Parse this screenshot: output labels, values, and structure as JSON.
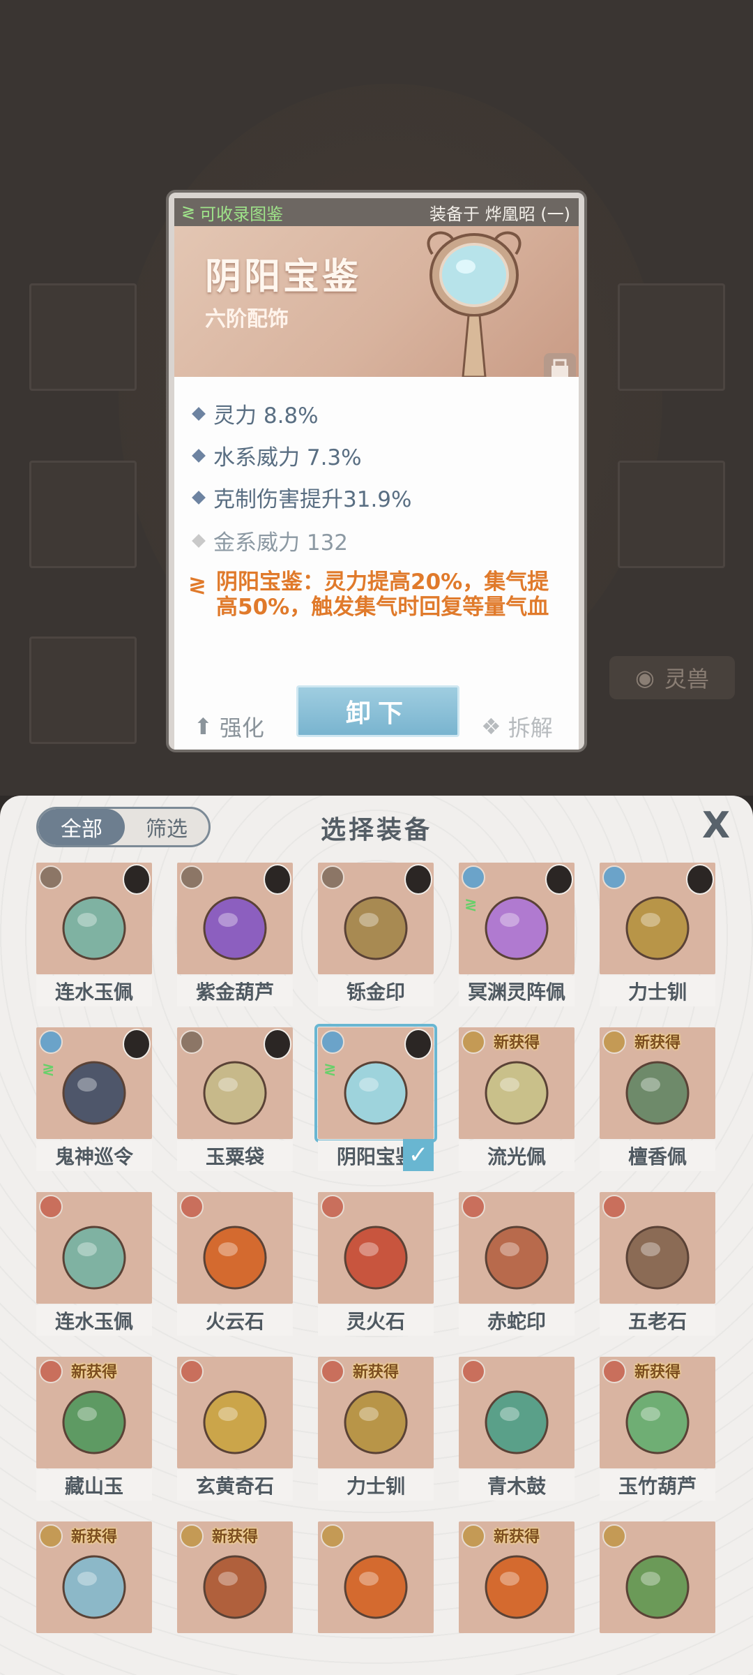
{
  "detail": {
    "collectable": "可收录图鉴",
    "equipped_on": "装备于 烨凰昭 (一)",
    "name": "阴阳宝鉴",
    "grade": "六阶配饰",
    "stats": [
      "灵力 8.8%",
      "水系威力 7.3%",
      "克制伤害提升31.9%"
    ],
    "extra_stat": "金系威力 132",
    "special": "阴阳宝鉴：灵力提高20%，集气提高50%，触发集气时回复等量气血",
    "upgrade": "强化",
    "unequip": "卸下",
    "dismantle": "拆解"
  },
  "background": {
    "beast_tab": "灵兽"
  },
  "sheet": {
    "filter_all": "全部",
    "filter_screen": "筛选",
    "title": "选择装备",
    "close": "X",
    "new_tag": "新获得",
    "items": [
      {
        "name": "连水玉佩",
        "element": "wood",
        "avatar": true,
        "new": false,
        "color": "#7fb2a2"
      },
      {
        "name": "紫金葫芦",
        "element": "wood",
        "avatar": true,
        "new": false,
        "color": "#8c5fbf"
      },
      {
        "name": "铄金印",
        "element": "wood",
        "avatar": true,
        "new": false,
        "color": "#a88a52"
      },
      {
        "name": "冥渊灵阵佩",
        "element": "water",
        "avatar": true,
        "new": false,
        "color": "#b07ad0",
        "mark": true
      },
      {
        "name": "力士钏",
        "element": "water",
        "avatar": true,
        "new": false,
        "color": "#b89548"
      },
      {
        "name": "鬼神巡令",
        "element": "water",
        "avatar": true,
        "new": false,
        "color": "#4e566a",
        "mark": true
      },
      {
        "name": "玉粟袋",
        "element": "wood",
        "avatar": true,
        "new": false,
        "color": "#c7b98a"
      },
      {
        "name": "阴阳宝鉴",
        "element": "water",
        "avatar": true,
        "new": false,
        "color": "#9ed3dc",
        "selected": true,
        "mark": true
      },
      {
        "name": "流光佩",
        "element": "gold",
        "avatar": false,
        "new": true,
        "color": "#c9c08a"
      },
      {
        "name": "檀香佩",
        "element": "gold",
        "avatar": false,
        "new": true,
        "color": "#6e8a6a"
      },
      {
        "name": "连水玉佩",
        "element": "fire",
        "avatar": false,
        "new": false,
        "color": "#7fb2a2"
      },
      {
        "name": "火云石",
        "element": "fire",
        "avatar": false,
        "new": false,
        "color": "#d46a2f"
      },
      {
        "name": "灵火石",
        "element": "fire",
        "avatar": false,
        "new": false,
        "color": "#c8553e"
      },
      {
        "name": "赤蛇印",
        "element": "fire",
        "avatar": false,
        "new": false,
        "color": "#b86a4c"
      },
      {
        "name": "五老石",
        "element": "fire",
        "avatar": false,
        "new": false,
        "color": "#8b6b55"
      },
      {
        "name": "藏山玉",
        "element": "fire",
        "avatar": false,
        "new": true,
        "color": "#5e9a63"
      },
      {
        "name": "玄黄奇石",
        "element": "fire",
        "avatar": false,
        "new": false,
        "color": "#cba54a"
      },
      {
        "name": "力士钏",
        "element": "fire",
        "avatar": false,
        "new": true,
        "color": "#b89548"
      },
      {
        "name": "青木鼓",
        "element": "fire",
        "avatar": false,
        "new": false,
        "color": "#5aa089"
      },
      {
        "name": "玉竹葫芦",
        "element": "fire",
        "avatar": false,
        "new": true,
        "color": "#6fae74"
      },
      {
        "name": "",
        "element": "gold",
        "avatar": false,
        "new": true,
        "color": "#8cb8c8"
      },
      {
        "name": "",
        "element": "gold",
        "avatar": false,
        "new": true,
        "color": "#b0603c"
      },
      {
        "name": "",
        "element": "gold",
        "avatar": false,
        "new": false,
        "color": "#d46a2f"
      },
      {
        "name": "",
        "element": "gold",
        "avatar": false,
        "new": true,
        "color": "#d46a2f"
      },
      {
        "name": "",
        "element": "gold",
        "avatar": false,
        "new": false,
        "color": "#6b9a58"
      }
    ]
  }
}
